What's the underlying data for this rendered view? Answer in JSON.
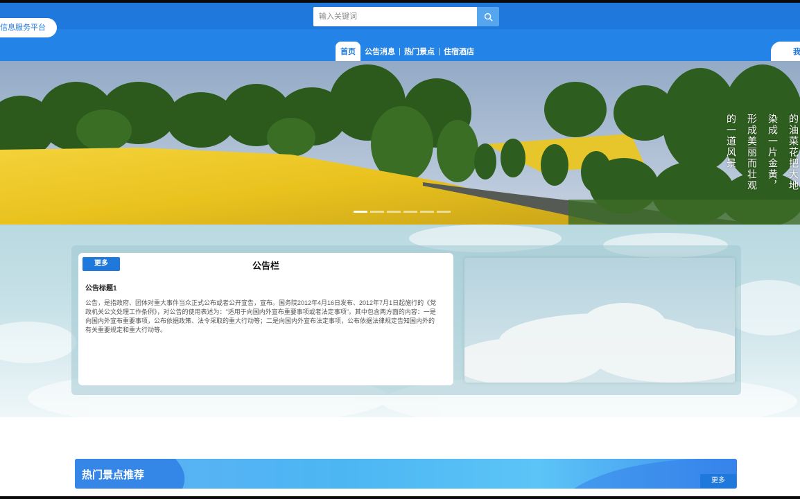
{
  "header": {
    "brand_text": "信息服务平台",
    "search": {
      "placeholder": "输入关键词",
      "icon": "search-icon"
    }
  },
  "nav": {
    "items": [
      {
        "label": "首页",
        "active": true
      },
      {
        "label": "公告消息",
        "active": false
      },
      {
        "label": "热门景点",
        "active": false
      },
      {
        "label": "住宿酒店",
        "active": false
      }
    ],
    "right_label": "我"
  },
  "banner": {
    "vertical_text_columns": [
      "的油菜花把大地",
      "染成一片金黄，",
      "形成美丽而壮观",
      "的一道风景"
    ],
    "dots": 6,
    "active_dot": 0
  },
  "notice": {
    "more_label": "更多",
    "title": "公告栏",
    "item_title": "公告标题1",
    "item_body": "公告，是指政府、团体对重大事件当众正式公布或者公开宣告，宣布。国务院2012年4月16日发布、2012年7月1日起施行的《党政机关公文处理工作条例》，对公告的使用表述为：\"适用于向国内外宣布重要事项或者法定事项\"。其中包含两方面的内容：一是向国内外宣布重要事项，公布依据政策、法令采取的重大行动等；二是向国内外宣布法定事项，公布依据法律规定告知国内外的有关重要规定和重大行动等。"
  },
  "hot": {
    "title": "热门景点推荐",
    "more_label": "更多"
  },
  "colors": {
    "primary": "#1f78db",
    "nav_bg": "#2383e6",
    "search_btn": "#56a6ef"
  }
}
